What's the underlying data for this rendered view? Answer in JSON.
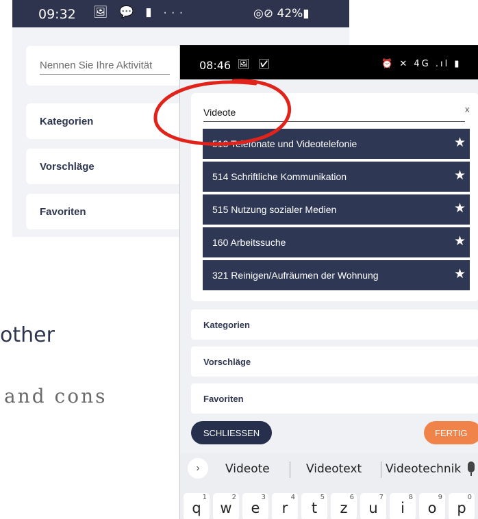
{
  "phone_a": {
    "status_bar": {
      "time": "09:32",
      "left_icons": "🖼 💬 ▮ ···",
      "right": "◎⊘ 42%▮"
    },
    "activity_placeholder": "Nennen Sie Ihre Aktivität",
    "sections": [
      "Kategorien",
      "Vorschläge",
      "Favoriten"
    ]
  },
  "slide": {
    "fragment_1": "other",
    "fragment_2": "and cons"
  },
  "phone_b": {
    "status_bar": {
      "time": "08:46",
      "left_icons": "🖼 ☑",
      "right": "⏰ ✕ 4G .ıl ▮"
    },
    "search": {
      "value": "Videote",
      "clear": "x"
    },
    "results": [
      {
        "label": "513 Telefonate und Videotelefonie"
      },
      {
        "label": "514 Schriftliche Kommunikation"
      },
      {
        "label": "515 Nutzung sozialer Medien"
      },
      {
        "label": "160 Arbeitssuche"
      },
      {
        "label": "321 Reinigen/Aufräumen der Wohnung"
      }
    ],
    "star_glyph": "★",
    "sections": [
      "Kategorien",
      "Vorschläge",
      "Favoriten"
    ],
    "buttons": {
      "close": "SCHLIESSEN",
      "done": "FERTIG"
    },
    "keyboard": {
      "chevron": "›",
      "suggestions": [
        "Videote",
        "Videotext",
        "Videotechnik"
      ],
      "keys": [
        {
          "letter": "q",
          "num": "1"
        },
        {
          "letter": "w",
          "num": "2"
        },
        {
          "letter": "e",
          "num": "3"
        },
        {
          "letter": "r",
          "num": "4"
        },
        {
          "letter": "t",
          "num": "5"
        },
        {
          "letter": "z",
          "num": "6"
        },
        {
          "letter": "u",
          "num": "7"
        },
        {
          "letter": "i",
          "num": "8"
        },
        {
          "letter": "o",
          "num": "9"
        },
        {
          "letter": "p",
          "num": "0"
        }
      ]
    }
  },
  "colors": {
    "navy": "#2e3754",
    "orange": "#f0834a",
    "annotation_red": "#e0241b"
  },
  "annotation": {
    "shape": "red-ellipse"
  }
}
